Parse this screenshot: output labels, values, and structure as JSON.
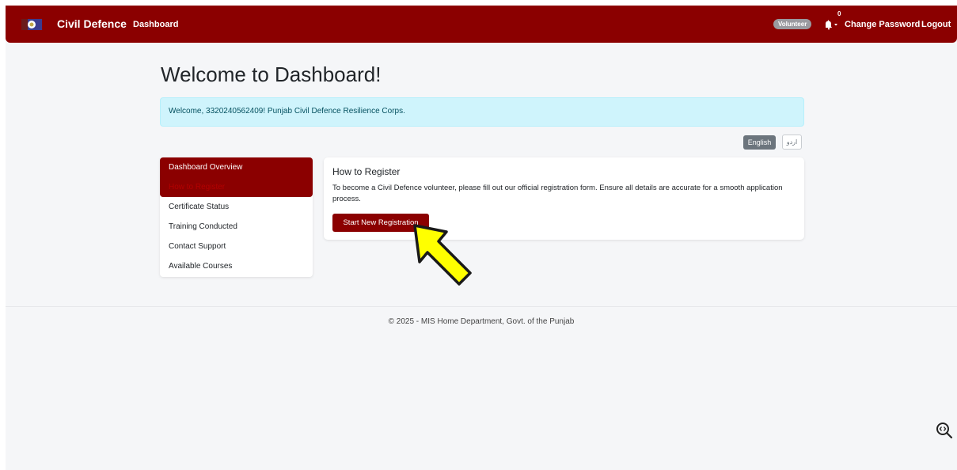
{
  "header": {
    "brand": "Civil Defence",
    "nav_dashboard": "Dashboard",
    "role_badge": "Volunteer",
    "notification_count": "0",
    "change_password": "Change Password",
    "logout": "Logout"
  },
  "main": {
    "title": "Welcome to Dashboard!",
    "alert": "Welcome, 3320240562409! Punjab Civil Defence Resilience Corps.",
    "languages": {
      "english": "English",
      "urdu": "اردو"
    }
  },
  "sidebar": {
    "items": [
      {
        "label": "Dashboard Overview"
      },
      {
        "label": "How to Register"
      },
      {
        "label": "Certificate Status"
      },
      {
        "label": "Training Conducted"
      },
      {
        "label": "Contact Support"
      },
      {
        "label": "Available Courses"
      }
    ]
  },
  "card": {
    "title": "How to Register",
    "text": "To become a Civil Defence volunteer, please fill out our official registration form. Ensure all details are accurate for a smooth application process.",
    "button": "Start New Registration"
  },
  "footer": {
    "text": "© 2025 - MIS Home Department, Govt. of the Punjab"
  },
  "colors": {
    "primary": "#8b0000",
    "alert_bg": "#cff4fc",
    "arrow": "#ffff00"
  },
  "icons": {
    "bell": "bell-icon",
    "logo": "civil-defence-logo",
    "zoom": "zoom-icon",
    "arrow": "pointer-arrow-icon"
  }
}
